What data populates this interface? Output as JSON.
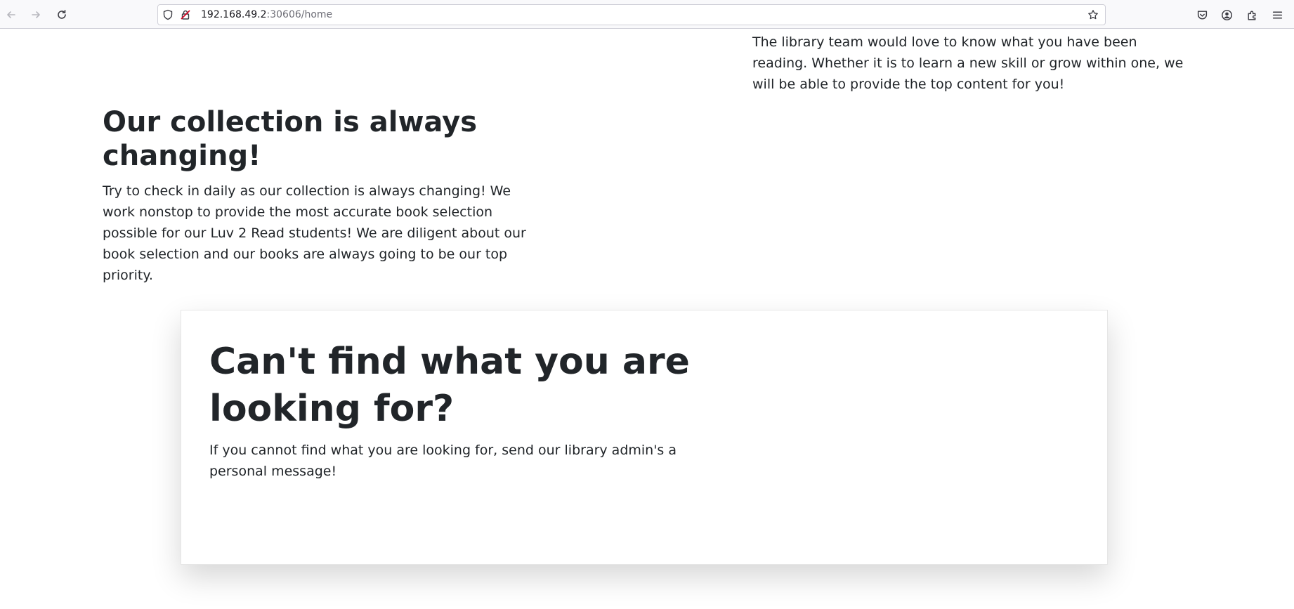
{
  "browser": {
    "url_host": "192.168.49.2",
    "url_rest": ":30606/home",
    "icons": [
      "back-icon",
      "forward-icon",
      "reload-icon",
      "shield-icon",
      "insecure-lock-icon",
      "bookmark-star-icon",
      "pocket-icon",
      "account-icon",
      "extensions-icon",
      "menu-icon"
    ]
  },
  "page": {
    "intro_right": "The library team would love to know what you have been reading. Whether it is to learn a new skill or grow within one, we will be able to provide the top content for you!",
    "collection_heading": "Our collection is always changing!",
    "collection_text": "Try to check in daily as our collection is always changing! We work nonstop to provide the most accurate book selection possible for our Luv 2 Read students! We are diligent about our book selection and our books are always going to be our top priority.",
    "card_heading": "Can't find what you are looking for?",
    "card_text": "If you cannot find what you are looking for, send our library admin's a personal message!"
  },
  "colors": {
    "text": "#212529",
    "toolbar_bg": "#f9f9fb",
    "url_muted": "#6c6c75"
  }
}
